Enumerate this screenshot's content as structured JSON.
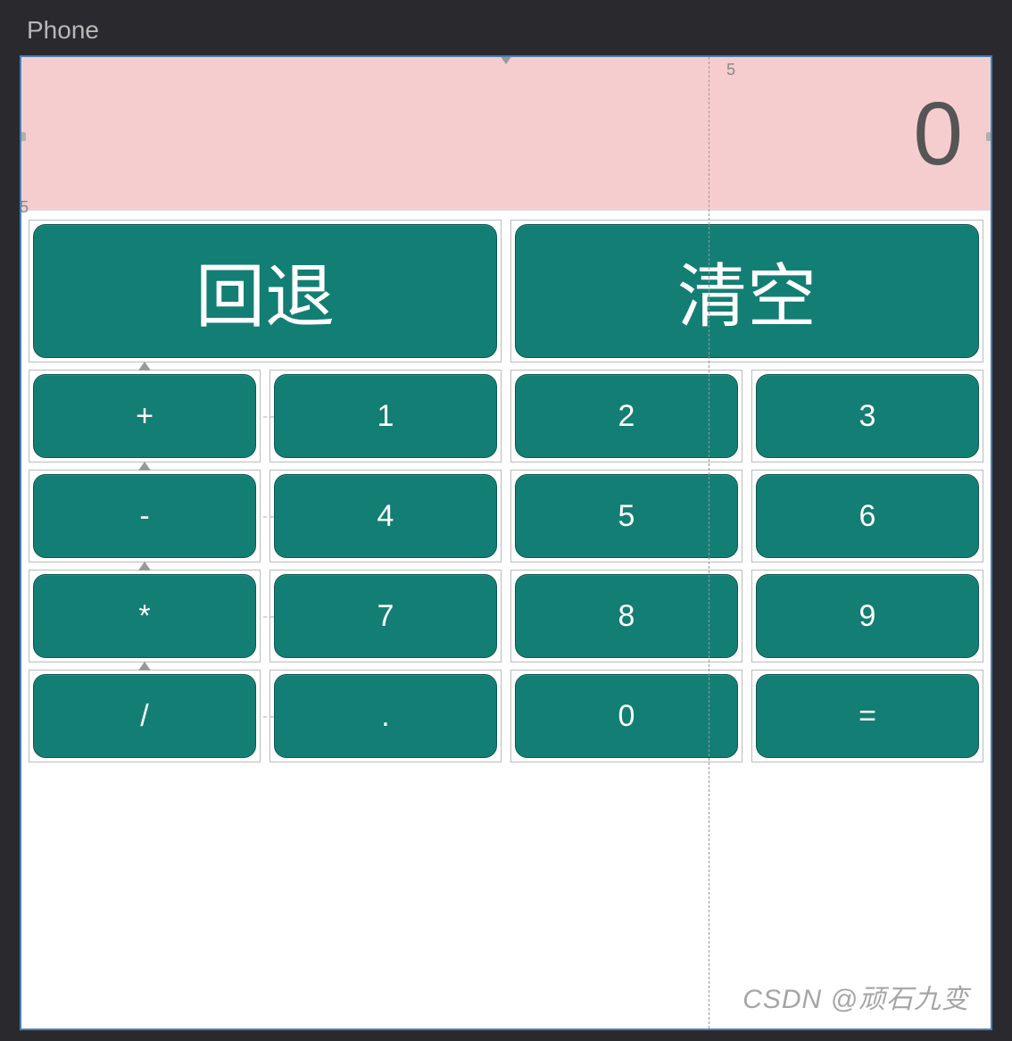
{
  "window": {
    "title": "Phone"
  },
  "display": {
    "value": "0"
  },
  "ruler": {
    "top_right": "5",
    "left_mid": "5"
  },
  "buttons": {
    "back": "回退",
    "clear": "清空",
    "rows": [
      {
        "op": "+",
        "a": "1",
        "b": "2",
        "c": "3"
      },
      {
        "op": "-",
        "a": "4",
        "b": "5",
        "c": "6"
      },
      {
        "op": "*",
        "a": "7",
        "b": "8",
        "c": "9"
      },
      {
        "op": "/",
        "a": ".",
        "b": "0",
        "c": "="
      }
    ]
  },
  "watermark": "CSDN @顽石九变",
  "colors": {
    "button_bg": "#137e74",
    "display_bg": "#f6cdce"
  }
}
